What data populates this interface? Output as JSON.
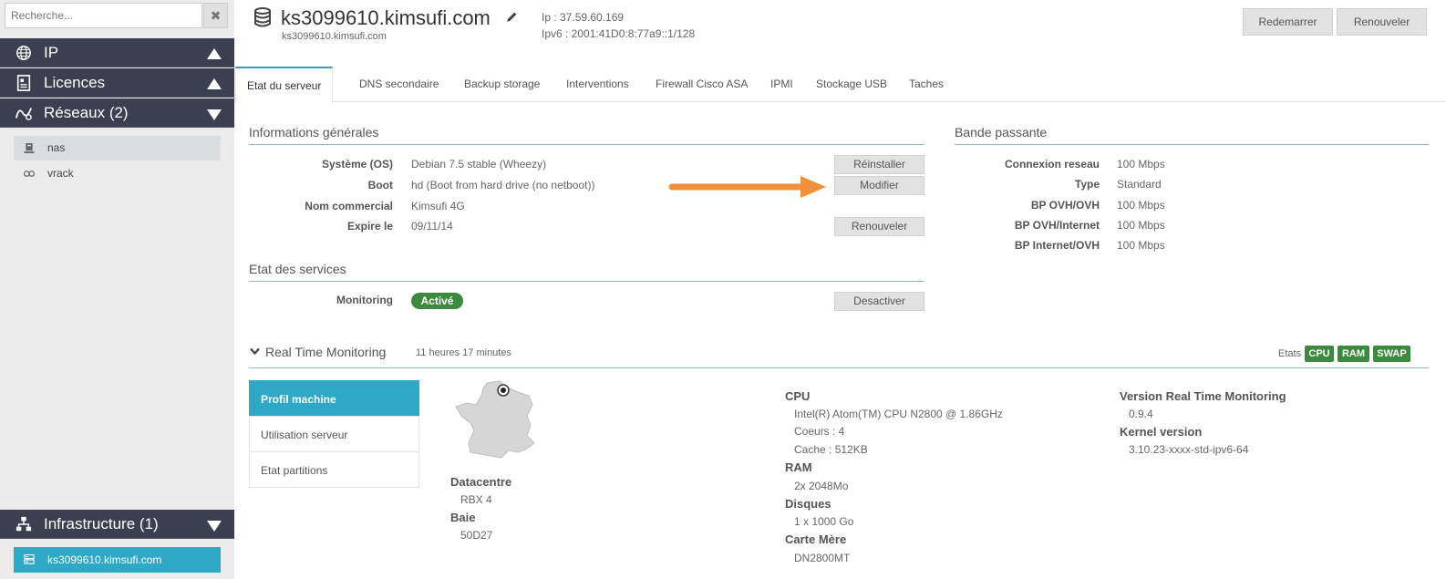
{
  "sidebar": {
    "search_placeholder": "Recherche...",
    "search_clear": "✖",
    "sections": [
      {
        "label": "IP",
        "icon": "globe-icon",
        "state": "up"
      },
      {
        "label": "Licences",
        "icon": "license-icon",
        "state": "up"
      },
      {
        "label": "Réseaux (2)",
        "icon": "network-icon",
        "state": "down"
      }
    ],
    "network_items": [
      {
        "label": "nas",
        "icon": "nas-icon"
      },
      {
        "label": "vrack",
        "icon": "link-icon"
      }
    ],
    "infrastructure": {
      "label": "Infrastructure (1)",
      "icon": "infrastructure-icon"
    },
    "server_item": {
      "label": "ks3099610.kimsufi.com",
      "icon": "server-icon"
    }
  },
  "header": {
    "title": "ks3099610.kimsufi.com",
    "subtitle": "ks3099610.kimsufi.com",
    "ip": "Ip : 37.59.60.169",
    "ipv6": "Ipv6 : 2001:41D0:8:77a9::1/128",
    "restart_label": "Redemarrer",
    "renew_label": "Renouveler"
  },
  "tabs": [
    "Etat du serveur",
    "DNS secondaire",
    "Backup storage",
    "Interventions",
    "Firewall Cisco ASA",
    "IPMI",
    "Stockage USB",
    "Taches"
  ],
  "general": {
    "title": "Informations générales",
    "rows": [
      {
        "label": "Système (OS)",
        "value": "Debian 7.5 stable (Wheezy)",
        "button": "Réinstaller"
      },
      {
        "label": "Boot",
        "value": "hd (Boot from hard drive (no netboot))",
        "button": "Modifier"
      },
      {
        "label": "Nom commercial",
        "value": "Kimsufi 4G",
        "button": ""
      },
      {
        "label": "Expire le",
        "value": "09/11/14",
        "button": "Renouveler"
      }
    ]
  },
  "services": {
    "title": "Etat des services",
    "monitoring_label": "Monitoring",
    "monitoring_status": "Activé",
    "deactivate_label": "Desactiver"
  },
  "bandwidth": {
    "title": "Bande passante",
    "rows": [
      {
        "label": "Connexion reseau",
        "value": "100 Mbps"
      },
      {
        "label": "Type",
        "value": "Standard"
      },
      {
        "label": "BP OVH/OVH",
        "value": "100 Mbps"
      },
      {
        "label": "BP OVH/Internet",
        "value": "100 Mbps"
      },
      {
        "label": "BP Internet/OVH",
        "value": "100 Mbps"
      }
    ]
  },
  "rtm": {
    "title": "Real Time Monitoring",
    "uptime": "11 heures 17 minutes",
    "states_label": "Etats",
    "states": [
      "CPU",
      "RAM",
      "SWAP"
    ],
    "side_tabs": [
      "Profil machine",
      "Utilisation serveur",
      "Etat partitions"
    ],
    "datacentre_label": "Datacentre",
    "datacentre_value": "RBX 4",
    "baie_label": "Baie",
    "baie_value": "50D27",
    "cpu_label": "CPU",
    "cpu_model": "Intel(R) Atom(TM) CPU N2800 @ 1.86GHz",
    "cpu_cores": "Coeurs : 4",
    "cpu_cache": "Cache : 512KB",
    "ram_label": "RAM",
    "ram_value": "2x 2048Mo",
    "disks_label": "Disques",
    "disks_value": "1 x 1000 Go",
    "mb_label": "Carte Mère",
    "mb_value": "DN2800MT",
    "version_label": "Version Real Time Monitoring",
    "version_value": "0.9.4",
    "kernel_label": "Kernel version",
    "kernel_value": "3.10.23-xxxx-std-ipv6-64"
  },
  "colors": {
    "accent": "#2fa7c6",
    "sidebar_dark": "#3b4050",
    "active_green": "#3b8a3e",
    "arrow": "#f0913a"
  }
}
